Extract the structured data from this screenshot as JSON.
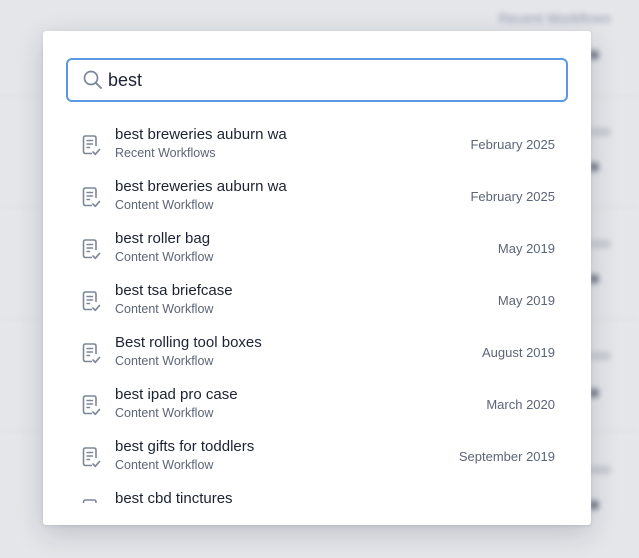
{
  "background": {
    "heading": "Recent Workflows"
  },
  "search": {
    "value": "best",
    "icon": "search-icon"
  },
  "results": [
    {
      "title": "best breweries auburn wa",
      "subtitle": "Recent Workflows",
      "date": "February 2025",
      "icon": "document-check-icon"
    },
    {
      "title": "best breweries auburn wa",
      "subtitle": "Content Workflow",
      "date": "February 2025",
      "icon": "document-check-icon"
    },
    {
      "title": "best roller bag",
      "subtitle": "Content Workflow",
      "date": "May 2019",
      "icon": "document-check-icon"
    },
    {
      "title": "best tsa briefcase",
      "subtitle": "Content Workflow",
      "date": "May 2019",
      "icon": "document-check-icon"
    },
    {
      "title": "Best rolling tool boxes",
      "subtitle": "Content Workflow",
      "date": "August 2019",
      "icon": "document-check-icon"
    },
    {
      "title": "best ipad pro case",
      "subtitle": "Content Workflow",
      "date": "March 2020",
      "icon": "document-check-icon"
    },
    {
      "title": "best gifts for toddlers",
      "subtitle": "Content Workflow",
      "date": "September 2019",
      "icon": "document-check-icon"
    },
    {
      "title": "best cbd tinctures",
      "subtitle": "",
      "date": "",
      "icon": "document-check-icon"
    }
  ],
  "colors": {
    "accent": "#5b9ae3",
    "icon": "#7d8799",
    "text_primary": "#1b2232",
    "text_secondary": "#5c6577"
  }
}
